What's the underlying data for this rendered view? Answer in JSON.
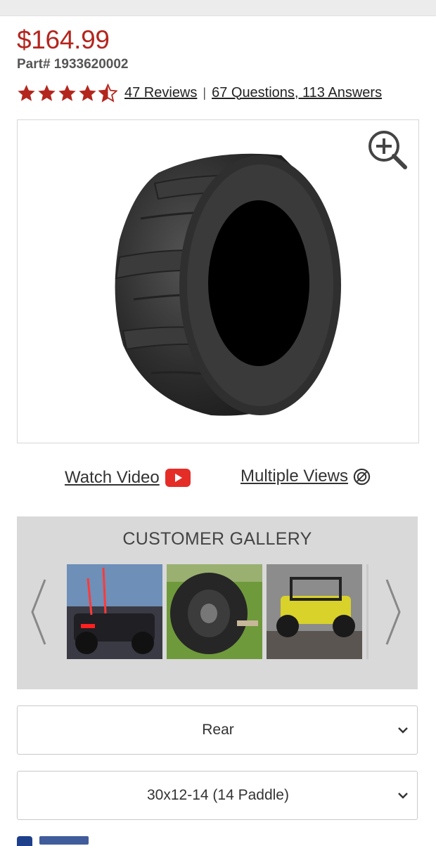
{
  "product": {
    "price": "$164.99",
    "part_number": "Part# 1933620002",
    "rating_value": 4.5,
    "rating_max": 5,
    "reviews_link": "47 Reviews",
    "separator": "|",
    "qa_link": "67 Questions, 113 Answers"
  },
  "media": {
    "watch_video_label": "Watch Video",
    "multiple_views_label": "Multiple Views"
  },
  "gallery": {
    "title": "CUSTOMER GALLERY"
  },
  "options": {
    "position_selected": "Rear",
    "size_selected": "30x12-14 (14 Paddle)"
  },
  "colors": {
    "price": "#b3261e",
    "stars": "#b3261e",
    "youtube": "#e52d27",
    "gallery_bg": "#d9d9d9"
  },
  "icons": {
    "zoom": "zoom-in-icon",
    "video": "youtube-play-icon",
    "views": "multiple-views-icon",
    "prev": "chevron-left-icon",
    "next": "chevron-right-icon",
    "dropdown": "chevron-down-icon"
  }
}
